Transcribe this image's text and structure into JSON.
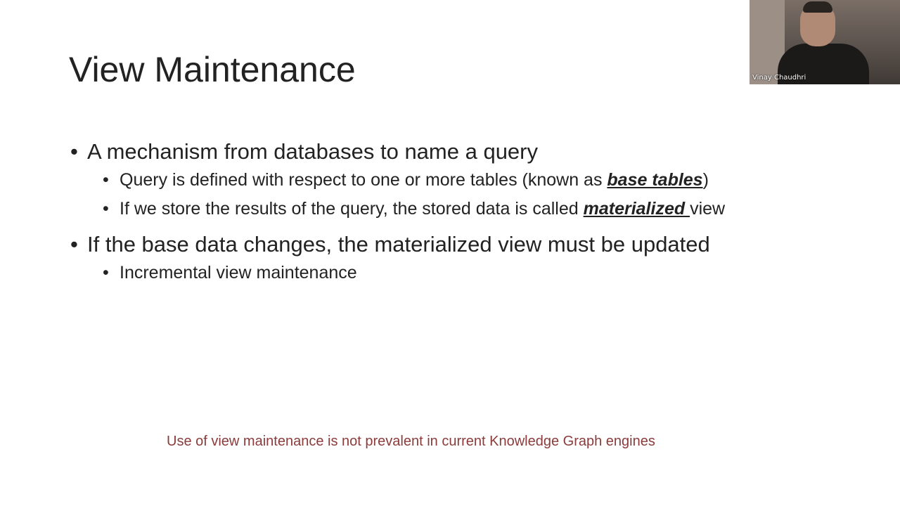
{
  "slide": {
    "title": "View Maintenance",
    "bullets": [
      {
        "text": "A mechanism from databases to name a query",
        "sub": [
          {
            "before": "Query is defined with respect to one or more tables (known as ",
            "emph": "base tables",
            "after": ")"
          },
          {
            "before": "If we store the results of the query, the stored data is called ",
            "emph": "materialized ",
            "after": "view"
          }
        ]
      },
      {
        "text": "If the base data changes, the materialized view must be updated",
        "sub": [
          {
            "text": "Incremental view maintenance"
          }
        ]
      }
    ],
    "bullet_symbol": "•",
    "footnote": "Use of view maintenance is not prevalent in current Knowledge Graph engines"
  },
  "video": {
    "participant_name": "Vinay Chaudhri"
  },
  "colors": {
    "footnote": "#8b3b3b",
    "text": "#222222",
    "background": "#ffffff"
  }
}
